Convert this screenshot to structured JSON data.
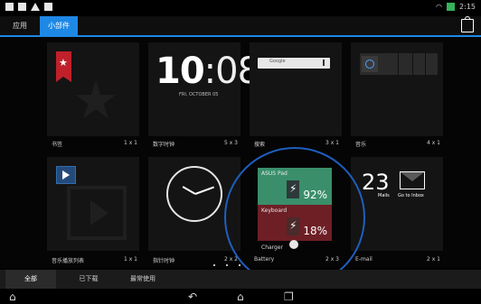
{
  "status_bar": {
    "time": "2:15"
  },
  "tabs": {
    "apps": "应用",
    "widgets": "小部件"
  },
  "widgets": [
    {
      "label": "书签",
      "size": "1 x 1"
    },
    {
      "label": "数字时钟",
      "size": "5 x 3",
      "time_hh": "10",
      "time_mm": ":08",
      "date": "FRI, OCTOBER 05"
    },
    {
      "label": "搜索",
      "size": "3 x 1",
      "search_text": "Google"
    },
    {
      "label": "音乐",
      "size": "4 x 1"
    },
    {
      "label": "音乐播放列表",
      "size": "1 x 1"
    },
    {
      "label": "指针时钟",
      "size": "2 x 2"
    },
    {
      "label": "Battery",
      "size": "2 x 3",
      "top_title": "ASUS Pad",
      "top_pct": "92%",
      "bottom_title": "Keyboard",
      "bottom_pct": "18%",
      "charger": "Charger"
    },
    {
      "label": "E-mail",
      "size": "2 x 1",
      "count": "23",
      "mails": "Mails",
      "goto": "Go to Inbox"
    }
  ],
  "filters": {
    "all": "全部",
    "downloaded": "已下载",
    "common": "最常使用"
  },
  "icons": [
    "bookmark-icon",
    "star-icon",
    "mic-icon",
    "music-icon",
    "play-icon",
    "clock-icon",
    "lightning-icon",
    "gear-icon",
    "envelope-icon",
    "store-icon",
    "back-icon",
    "home-icon",
    "recent-apps-icon",
    "hide-keyboard-icon"
  ],
  "colors": {
    "accent": "#1e88e5",
    "battery_top": "#3a8f6a",
    "battery_bottom": "#6e1f25",
    "circle": "#1e5fbf"
  }
}
